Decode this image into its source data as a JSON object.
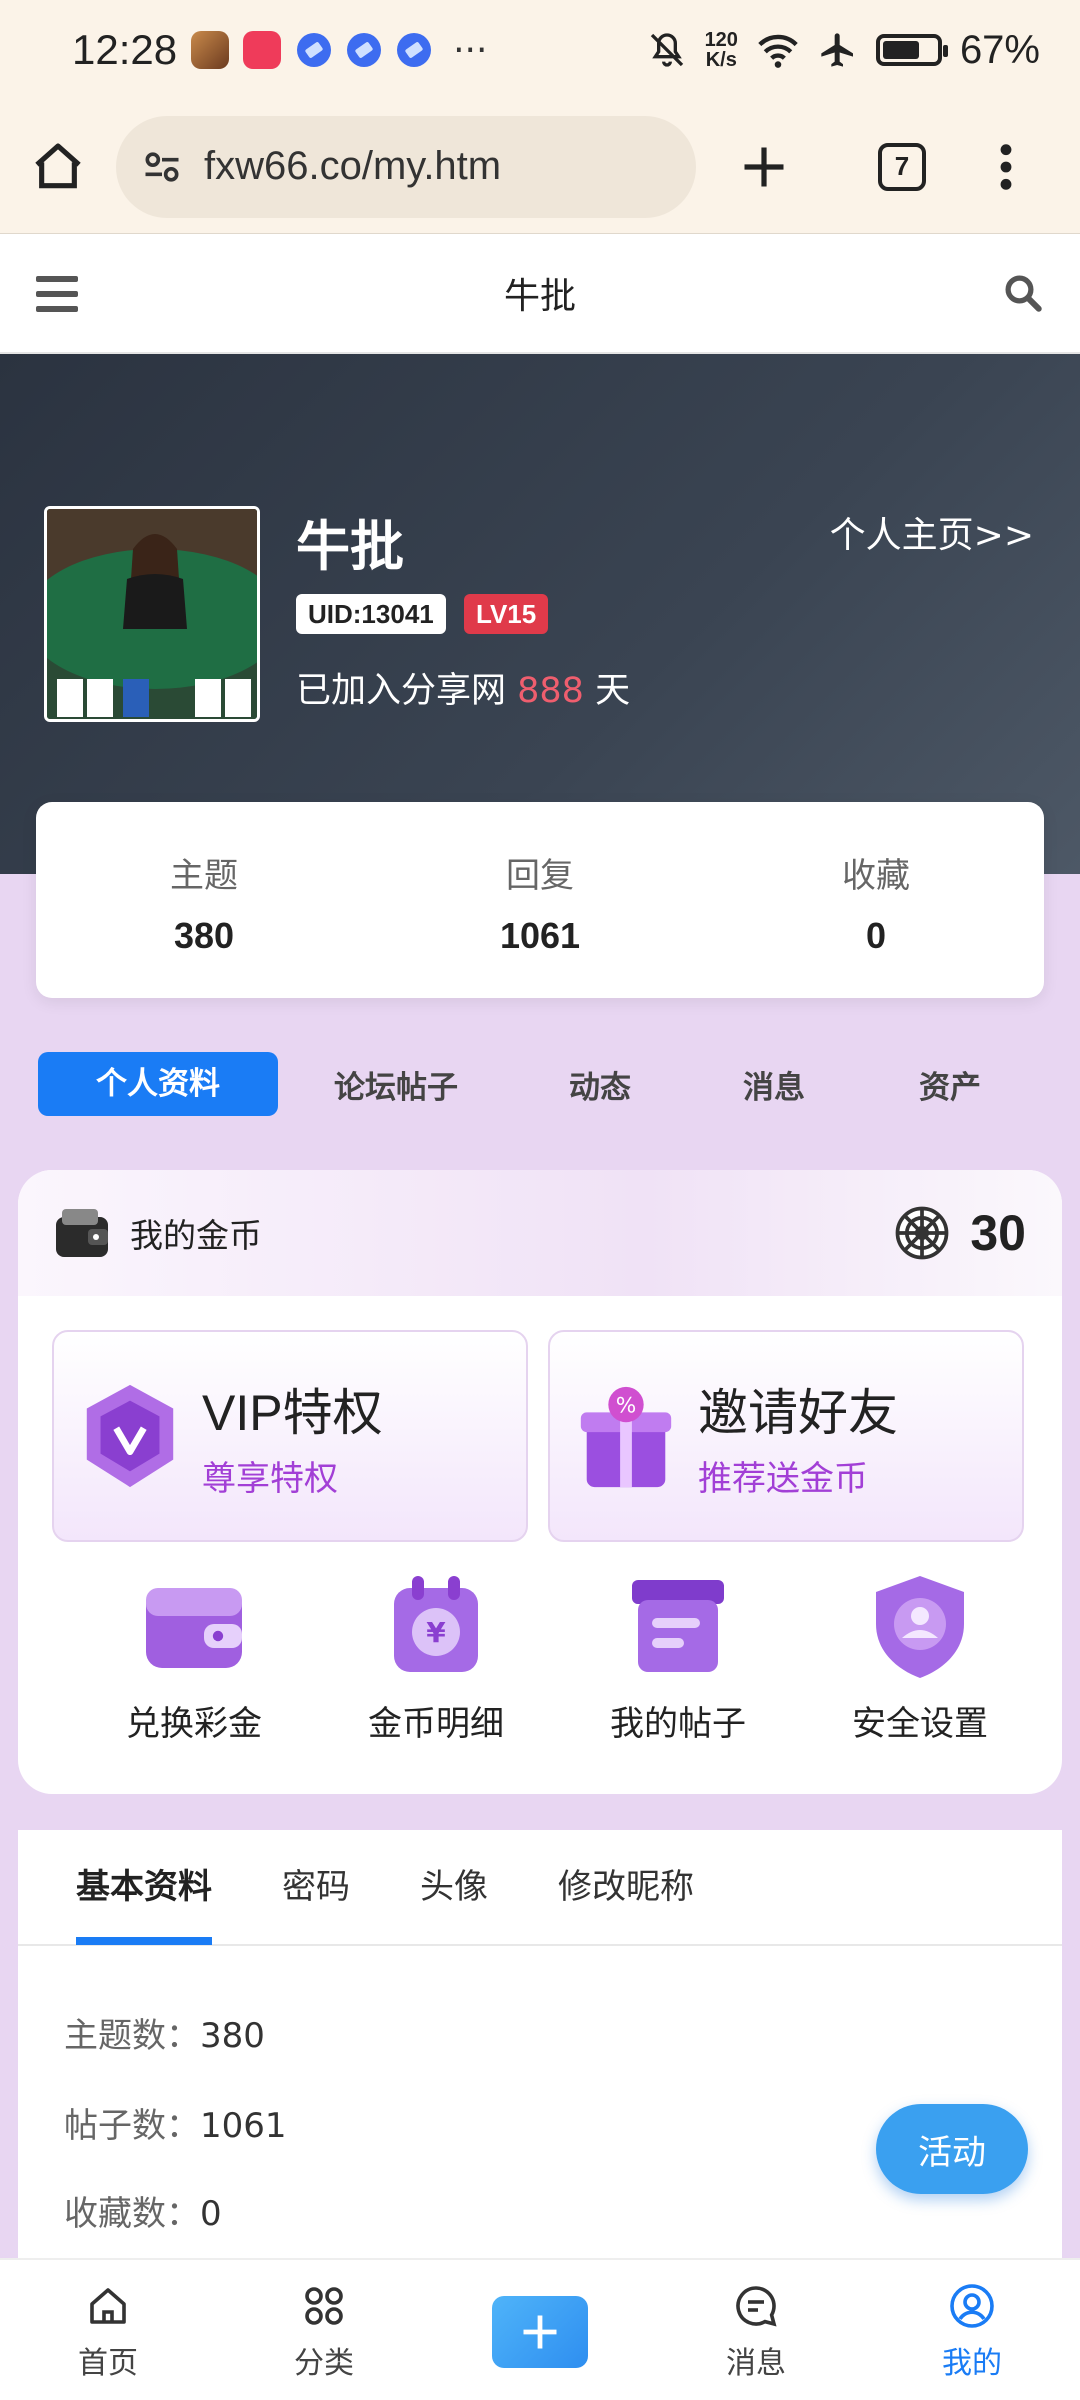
{
  "status_bar": {
    "time": "12:28",
    "more": "···",
    "speed_top": "120",
    "speed_bottom": "K/s",
    "battery": "67%"
  },
  "browser": {
    "url": "fxw66.co/my.htm",
    "tab_count": "7"
  },
  "site_header": {
    "title": "牛批"
  },
  "profile": {
    "name": "牛批",
    "home_link": "个人主页>>",
    "uid": "UID:13041",
    "level": "LV15",
    "joined_prefix": "已加入分享网 ",
    "joined_days": "888",
    "joined_suffix": " 天"
  },
  "stats": [
    {
      "label": "主题",
      "value": "380"
    },
    {
      "label": "回复",
      "value": "1061"
    },
    {
      "label": "收藏",
      "value": "0"
    }
  ],
  "nav_tabs": [
    "个人资料",
    "论坛帖子",
    "动态",
    "消息",
    "资产"
  ],
  "coins": {
    "title": "我的金币",
    "amount": "30"
  },
  "promos": [
    {
      "title": "VIP特权",
      "subtitle": "尊享特权"
    },
    {
      "title": "邀请好友",
      "subtitle": "推荐送金币"
    }
  ],
  "quick_actions": [
    "兑换彩金",
    "金币明细",
    "我的帖子",
    "安全设置"
  ],
  "info_tabs": [
    "基本资料",
    "密码",
    "头像",
    "修改昵称"
  ],
  "info_rows": [
    {
      "key": "主题数：",
      "value": "380"
    },
    {
      "key": "帖子数：",
      "value": "1061"
    },
    {
      "key": "收藏数：",
      "value": "0"
    }
  ],
  "fab": "活动",
  "bottom_nav": [
    "首页",
    "分类",
    "消息",
    "我的"
  ],
  "colors": {
    "accent": "#1a7cf5",
    "level_badge": "#e03a4a",
    "promo_sub": "#a23fd6"
  }
}
